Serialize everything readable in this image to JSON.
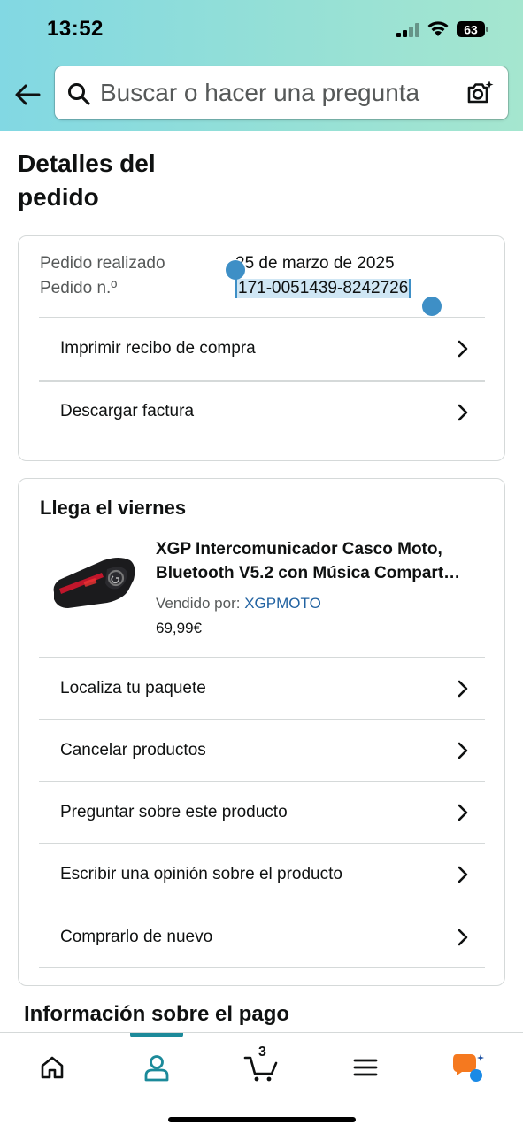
{
  "status_bar": {
    "time": "13:52",
    "battery": "63"
  },
  "search": {
    "placeholder": "Buscar o hacer una pregunta"
  },
  "page": {
    "title_line1": "Detalles del",
    "title_line2": "pedido"
  },
  "order_info": {
    "placed_label": "Pedido realizado",
    "placed_value": "25 de marzo de 2025",
    "number_label": "Pedido n.º",
    "number_value": "171-0051439-8242726",
    "actions": [
      {
        "label": "Imprimir recibo de compra"
      },
      {
        "label": "Descargar factura"
      }
    ]
  },
  "shipment": {
    "heading": "Llega el viernes",
    "product": {
      "title_line1": "XGP Intercomunicador Casco Moto,",
      "title_line2": "Bluetooth V5.2 con Música Compart…",
      "seller_label": "Vendido por:",
      "seller_name": "XGPMOTO",
      "price": "69,99€"
    },
    "actions": [
      {
        "label": "Localiza tu paquete"
      },
      {
        "label": "Cancelar productos"
      },
      {
        "label": "Preguntar sobre este producto"
      },
      {
        "label": "Escribir una opinión sobre el producto"
      },
      {
        "label": "Comprarlo de nuevo"
      }
    ]
  },
  "payment": {
    "heading": "Información sobre el pago"
  },
  "bottom_nav": {
    "cart_count": "3",
    "items": [
      {
        "icon": "home-icon"
      },
      {
        "icon": "account-icon"
      },
      {
        "icon": "cart-icon"
      },
      {
        "icon": "menu-icon"
      },
      {
        "icon": "rufus-assistant-icon"
      }
    ],
    "active_index": 1
  },
  "colors": {
    "header_gradient_start": "#82d8e3",
    "header_gradient_end": "#a5e6cf",
    "link": "#2162a1",
    "selection": "#3e8fc6",
    "active_nav": "#1c8a9a"
  }
}
